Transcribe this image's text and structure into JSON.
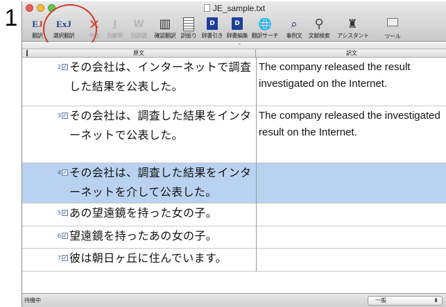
{
  "step_number": "1",
  "window": {
    "title": "JE_sample.txt"
  },
  "toolbar": {
    "items": [
      {
        "label": "翻訳",
        "icon": "ej-translate-icon",
        "glyph_a": "E",
        "glyph_b": "J"
      },
      {
        "label": "選択翻訳",
        "icon": "ej-selection-translate-icon",
        "glyph": "ExJ"
      },
      {
        "label": "中止",
        "icon": "stop-x-icon",
        "glyph": "✕"
      },
      {
        "label": "別解釈",
        "icon": "alternative-interpretation-icon",
        "glyph": "J"
      },
      {
        "label": "別訳語",
        "icon": "alternative-wording-icon",
        "glyph": "W"
      },
      {
        "label": "確認翻訳",
        "icon": "confirm-translate-columns-icon",
        "glyph": "▥"
      },
      {
        "label": "訳振り",
        "icon": "interlinear-document-icon",
        "glyph": ""
      },
      {
        "label": "辞書引き",
        "icon": "dictionary-lookup-book-icon",
        "glyph": "D"
      },
      {
        "label": "辞書編集",
        "icon": "dictionary-edit-book-icon",
        "glyph": "D"
      },
      {
        "label": "翻訳サーチ",
        "icon": "translation-search-globe-icon",
        "glyph": "🌐"
      },
      {
        "label": "事例文",
        "icon": "example-sentence-icon",
        "glyph": "⌕"
      },
      {
        "label": "文献検索",
        "icon": "literature-search-magnifier-icon",
        "glyph": "⚲"
      },
      {
        "label": "アシスタント",
        "icon": "assistant-person-icon",
        "glyph": "♜"
      },
      {
        "label": "ツール",
        "icon": "tool-icon",
        "glyph": ""
      }
    ]
  },
  "columns": {
    "source": "原文",
    "target": "訳文"
  },
  "rows": [
    {
      "num": "2",
      "checked": "✓",
      "source": "その会社は、インターネットで調査した結果を公表した。",
      "target": "The company released the result investigated on the Internet.",
      "selected": false
    },
    {
      "num": "3",
      "checked": "✓",
      "source": "その会社は、調査した結果をインターネットで公表した。",
      "target": "The company released the investigated result on the Internet.",
      "selected": false
    },
    {
      "num": "4",
      "checked": "✓",
      "source": "その会社は、調査した結果をインターネットを介して公表した。",
      "target": "",
      "selected": true
    },
    {
      "num": "5",
      "checked": "✓",
      "source": "あの望遠鏡を持った女の子。",
      "target": "",
      "selected": false
    },
    {
      "num": "6",
      "checked": "✓",
      "source": "望遠鏡を持ったあの女の子。",
      "target": "",
      "selected": false
    },
    {
      "num": "7",
      "checked": "✓",
      "source": "彼は朝日ヶ丘に住んでいます。",
      "target": "",
      "selected": false
    }
  ],
  "status": {
    "text": "待機中",
    "mode_value": "一般",
    "mode_arrow": "⬍"
  },
  "colors": {
    "accent_selection": "#b9d2f0",
    "highlight_circle": "#cc3b2b",
    "row_number": "#2f5ea8"
  }
}
